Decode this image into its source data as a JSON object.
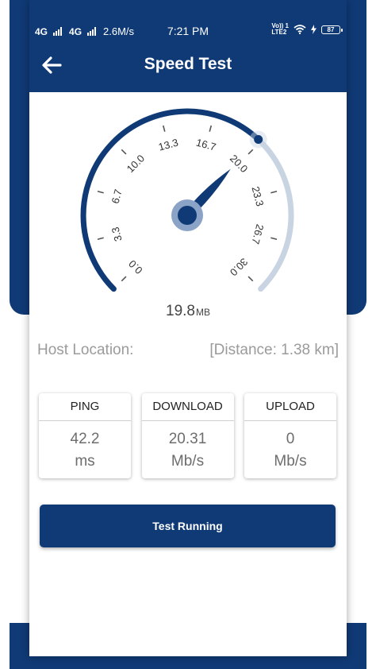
{
  "status_bar": {
    "sim1": "4G",
    "sim2": "4G",
    "net_speed": "2.6M/s",
    "time": "7:21 PM",
    "volte_top": "Vo)) 1",
    "volte_bottom": "LTE2",
    "battery": "87"
  },
  "header": {
    "title": "Speed Test"
  },
  "gauge": {
    "ticks": [
      "0.0",
      "3.3",
      "6.7",
      "10.0",
      "13.3",
      "16.7",
      "20.0",
      "23.3",
      "26.7",
      "30.0"
    ],
    "min": 0,
    "max": 30,
    "needle_value": 19.8,
    "display_value": "19.8",
    "display_unit": "MB",
    "colors": {
      "active": "#103a76",
      "inactive": "#c9d4e3",
      "needle": "#103a76"
    }
  },
  "host": {
    "label": "Host Location:",
    "distance": "[Distance: 1.38 km]"
  },
  "stats": {
    "ping": {
      "label": "PING",
      "value": "42.2",
      "unit": "ms"
    },
    "download": {
      "label": "DOWNLOAD",
      "value": "20.31",
      "unit": "Mb/s"
    },
    "upload": {
      "label": "UPLOAD",
      "value": "0",
      "unit": "Mb/s"
    }
  },
  "action": {
    "label": "Test Running"
  }
}
